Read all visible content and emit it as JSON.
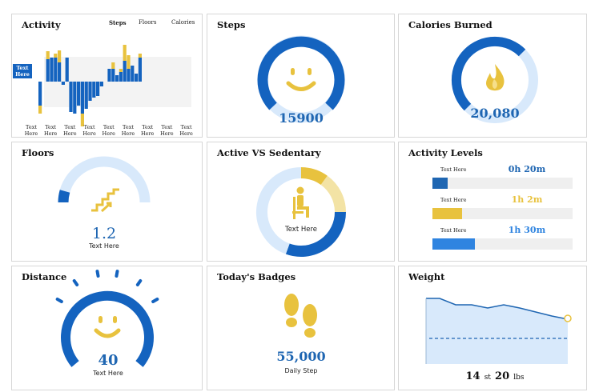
{
  "activity": {
    "title": "Activity",
    "tabs": [
      "Steps",
      "Floors",
      "Calories"
    ],
    "marker_label": "Text Here",
    "x_labels": [
      "Text Here",
      "Text Here",
      "Text Here",
      "Text Here",
      "Text Here",
      "Text Here",
      "Text Here",
      "Text Here",
      "Text Here"
    ]
  },
  "steps": {
    "title": "Steps",
    "value": "15900",
    "progress": 0.78
  },
  "calories": {
    "title": "Calories Burned",
    "value": "20,080",
    "progress": 0.62
  },
  "floors": {
    "title": "Floors",
    "value": "1.2",
    "caption": "Text Here",
    "progress": 0.12
  },
  "active_sedentary": {
    "title": "Active VS Sedentary",
    "caption": "Text Here"
  },
  "activity_levels": {
    "title": "Activity Levels",
    "rows": [
      {
        "label": "Text Here",
        "value": "0h 20m",
        "color": "#1f66b2",
        "fill": 0.11
      },
      {
        "label": "Text Here",
        "value": "1h 2m",
        "color": "#e8c23e",
        "fill": 0.21
      },
      {
        "label": "Text Here",
        "value": "1h 30m",
        "color": "#2f84e0",
        "fill": 0.3
      }
    ]
  },
  "distance": {
    "title": "Distance",
    "value": "40",
    "caption": "Text Here",
    "progress": 0.78
  },
  "badges": {
    "title": "Today's Badges",
    "value": "55,000",
    "caption": "Daily Step"
  },
  "weight": {
    "title": "Weight",
    "st_value": "14",
    "st_unit": "st",
    "lbs_value": "20",
    "lbs_unit": "lbs"
  },
  "colors": {
    "blue": "#1463bf",
    "yellow": "#e8c23e",
    "light_blue": "#d8e9fb",
    "light_yellow": "#f3e3a5"
  }
}
